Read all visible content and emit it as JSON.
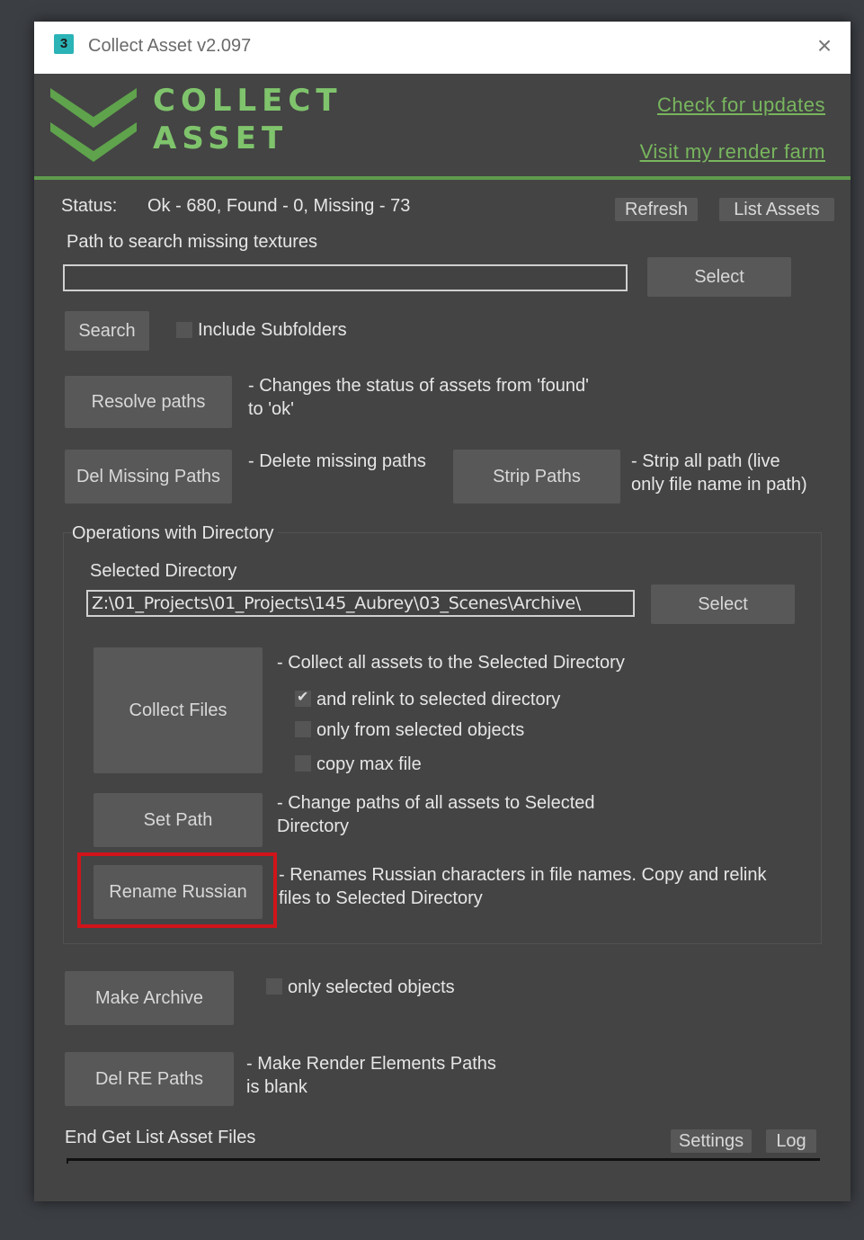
{
  "window": {
    "title": "Collect Asset v2.097",
    "app_icon": "3",
    "close_symbol": "×"
  },
  "header": {
    "logo_line1": "Collect",
    "logo_line2": "Asset",
    "link_updates": "Check for updates",
    "link_farm": "Visit my render farm",
    "dot": "."
  },
  "status": {
    "label": "Status:",
    "text": "Ok - 680, Found - 0, Missing - 73",
    "refresh_button": "Refresh",
    "list_assets_button": "List Assets"
  },
  "search_path": {
    "label": "Path to search missing textures",
    "value": "",
    "select_button": "Select",
    "search_button": "Search",
    "include_subfolders": "Include Subfolders"
  },
  "resolve": {
    "button": "Resolve paths",
    "desc_line1": "- Changes the status of assets from 'found'",
    "desc_line2": "to 'ok'"
  },
  "del_missing": {
    "button": "Del Missing Paths",
    "desc": "- Delete missing paths"
  },
  "strip": {
    "button": "Strip Paths",
    "desc_line1": "- Strip all path (live",
    "desc_line2": "only file name in path)"
  },
  "directory_group": {
    "title": "Operations with Directory",
    "selected_label": "Selected Directory",
    "path": "Z:\\01_Projects\\01_Projects\\145_Aubrey\\03_Scenes\\Archive\\",
    "select_button": "Select"
  },
  "collect": {
    "button": "Collect Files",
    "desc": "- Collect all assets to the Selected Directory",
    "opt_relink": "and relink to selected directory",
    "opt_selected": "only from selected objects",
    "opt_copy_max": "copy max file"
  },
  "set_path": {
    "button": "Set Path",
    "desc_line1": "- Change paths of all assets to Selected",
    "desc_line2": "Directory"
  },
  "rename": {
    "button": "Rename Russian",
    "desc_line1": "- Renames Russian characters in file names. Copy and relink",
    "desc_line2": "files to Selected Directory"
  },
  "archive": {
    "button": "Make Archive",
    "opt_selected": "only selected objects"
  },
  "del_re": {
    "button": "Del RE Paths",
    "desc_line1": "- Make Render Elements Paths",
    "desc_line2": "is blank"
  },
  "footer": {
    "status": "End Get List Asset Files",
    "settings_button": "Settings",
    "log_button": "Log"
  },
  "colors": {
    "accent_green": "#7fc46c",
    "highlight_red": "#d0141a"
  }
}
